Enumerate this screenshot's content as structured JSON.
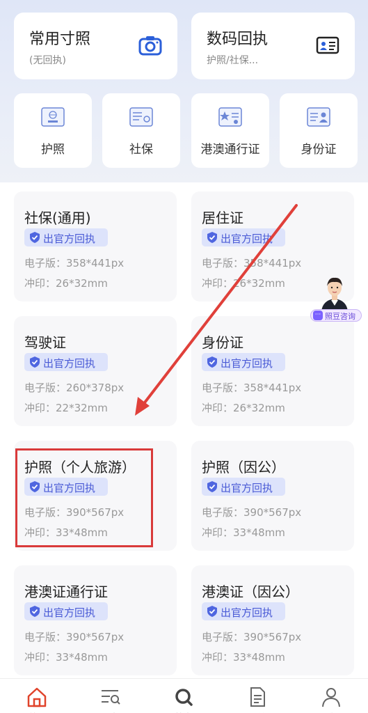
{
  "top_cards": [
    {
      "title": "常用寸照",
      "subtitle": "(无回执)",
      "icon": "camera-icon"
    },
    {
      "title": "数码回执",
      "subtitle": "护照/社保...",
      "icon": "id-card-icon"
    }
  ],
  "categories": [
    {
      "label": "护照",
      "icon": "passport-icon"
    },
    {
      "label": "社保",
      "icon": "social-security-card-icon"
    },
    {
      "label": "港澳通行证",
      "icon": "hk-macau-permit-icon"
    },
    {
      "label": "身份证",
      "icon": "id-card-icon"
    }
  ],
  "badge_text": "出官方回执",
  "documents": [
    {
      "name": "社保(通用)",
      "spec_digital": "电子版：358*441px",
      "spec_print": "冲印：26*32mm"
    },
    {
      "name": "居住证",
      "spec_digital": "电子版：358*441px",
      "spec_print": "冲印：26*32mm"
    },
    {
      "name": "驾驶证",
      "spec_digital": "电子版：260*378px",
      "spec_print": "冲印：22*32mm"
    },
    {
      "name": "身份证",
      "spec_digital": "电子版：358*441px",
      "spec_print": "冲印：26*32mm"
    },
    {
      "name": "护照（个人旅游）",
      "spec_digital": "电子版：390*567px",
      "spec_print": "冲印：33*48mm"
    },
    {
      "name": "护照（因公）",
      "spec_digital": "电子版：390*567px",
      "spec_print": "冲印：33*48mm"
    },
    {
      "name": "港澳证通行证",
      "spec_digital": "电子版：390*567px",
      "spec_print": "冲印：33*48mm"
    },
    {
      "name": "港澳证（因公）",
      "spec_digital": "电子版：390*567px",
      "spec_print": "冲印：33*48mm"
    }
  ],
  "consult": {
    "label": "照豆咨询"
  },
  "tabbar": [
    {
      "label": "首页",
      "icon": "home-icon",
      "active": true
    },
    {
      "label": "分类",
      "icon": "category-icon",
      "active": false
    },
    {
      "label": "搜索",
      "icon": "search-icon",
      "active": false
    },
    {
      "label": "订单",
      "icon": "order-icon",
      "active": false
    },
    {
      "label": "我",
      "icon": "user-icon",
      "active": false
    }
  ],
  "colors": {
    "accent": "#e0432b",
    "badge_bg": "#dde3fb",
    "badge_text": "#4a5bd6",
    "highlight": "#d93a3a"
  }
}
